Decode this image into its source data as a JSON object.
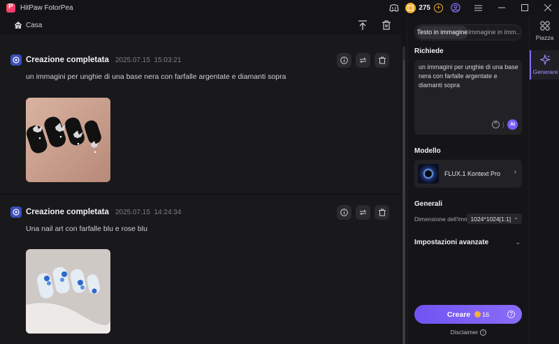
{
  "window": {
    "title": "HitPaw FotorPea",
    "coins": "275"
  },
  "main": {
    "breadcrumb": "Casa",
    "cards": [
      {
        "status": "Creazione completata",
        "date": "2025.07.15",
        "time": "15:03:21",
        "prompt": "un immagini per unghie di una base nera con farfalle argentate e diamanti sopra"
      },
      {
        "status": "Creazione completata",
        "date": "2025.07.15",
        "time": "14:24:34",
        "prompt": "Una nail art con farfalle blu e rose blu"
      }
    ]
  },
  "panel": {
    "tabs": [
      "Testo in immagine",
      "Immagine in imm..."
    ],
    "active_tab": 0,
    "prompt_label": "Richiede",
    "prompt_value": "un immagini per unghie di una base nera con farfalle argentate e diamanti sopra",
    "ai_badge": "AI",
    "model_label": "Modello",
    "model_name": "FLUX.1 Kontext Pro",
    "general_label": "Generali",
    "size_label": "Dimensione dell'imm...",
    "size_value": "1024*1024[1:1]",
    "advanced_label": "Impostazioni avanzate",
    "create_label": "Creare",
    "create_cost": "16",
    "disclaimer": "Disclaimer"
  },
  "rail": {
    "items": [
      {
        "label": "Piazza",
        "icon": "grid-icon"
      },
      {
        "label": "Generare",
        "icon": "sparkle-icon"
      }
    ],
    "active": 1
  },
  "colors": {
    "accent": "#7b5cff",
    "coin": "#f2b233",
    "background": "#141416"
  }
}
